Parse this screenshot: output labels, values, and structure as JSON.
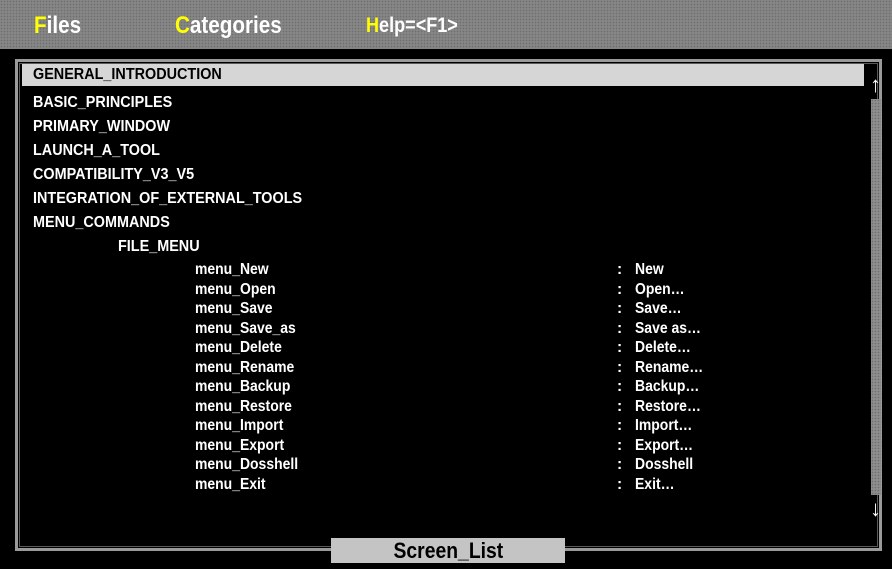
{
  "menubar": {
    "files": {
      "hot": "F",
      "rest": "iles"
    },
    "categories": {
      "hot": "C",
      "rest": "ategories"
    },
    "help": {
      "hot": "H",
      "rest": "elp=<F1>"
    }
  },
  "list": {
    "items": [
      {
        "label": "GENERAL_INTRODUCTION",
        "selected": true
      },
      {
        "label": "BASIC_PRINCIPLES"
      },
      {
        "label": "PRIMARY_WINDOW"
      },
      {
        "label": "LAUNCH_A_TOOL"
      },
      {
        "label": "COMPATIBILITY_V3_V5"
      },
      {
        "label": "INTEGRATION_OF_EXTERNAL_TOOLS"
      },
      {
        "label": "MENU_COMMANDS"
      },
      {
        "label": "FILE_MENU"
      }
    ],
    "file_menu_entries": [
      {
        "name": "menu_New",
        "sep": ":",
        "label": "New"
      },
      {
        "name": "menu_Open",
        "sep": ":",
        "label": "Open…"
      },
      {
        "name": "menu_Save",
        "sep": ":",
        "label": "Save…"
      },
      {
        "name": "menu_Save_as",
        "sep": ":",
        "label": "Save as…"
      },
      {
        "name": "menu_Delete",
        "sep": ":",
        "label": "Delete…"
      },
      {
        "name": "menu_Rename",
        "sep": ":",
        "label": "Rename…"
      },
      {
        "name": "menu_Backup",
        "sep": ":",
        "label": "Backup…"
      },
      {
        "name": "menu_Restore",
        "sep": ":",
        "label": "Restore…"
      },
      {
        "name": "menu_Import",
        "sep": ":",
        "label": "Import…"
      },
      {
        "name": "menu_Export",
        "sep": ":",
        "label": "Export…"
      },
      {
        "name": "menu_Dosshell",
        "sep": ":",
        "label": "Dosshell"
      },
      {
        "name": "menu_Exit",
        "sep": ":",
        "label": "Exit…"
      }
    ]
  },
  "scrollbar": {
    "up_icon": "↑",
    "down_icon": "↓"
  },
  "footer": {
    "tab_label": "Screen_List"
  },
  "colors": {
    "hotkey": "#ffff00",
    "menubar": "#868686",
    "selection": "#d6d6d6"
  }
}
